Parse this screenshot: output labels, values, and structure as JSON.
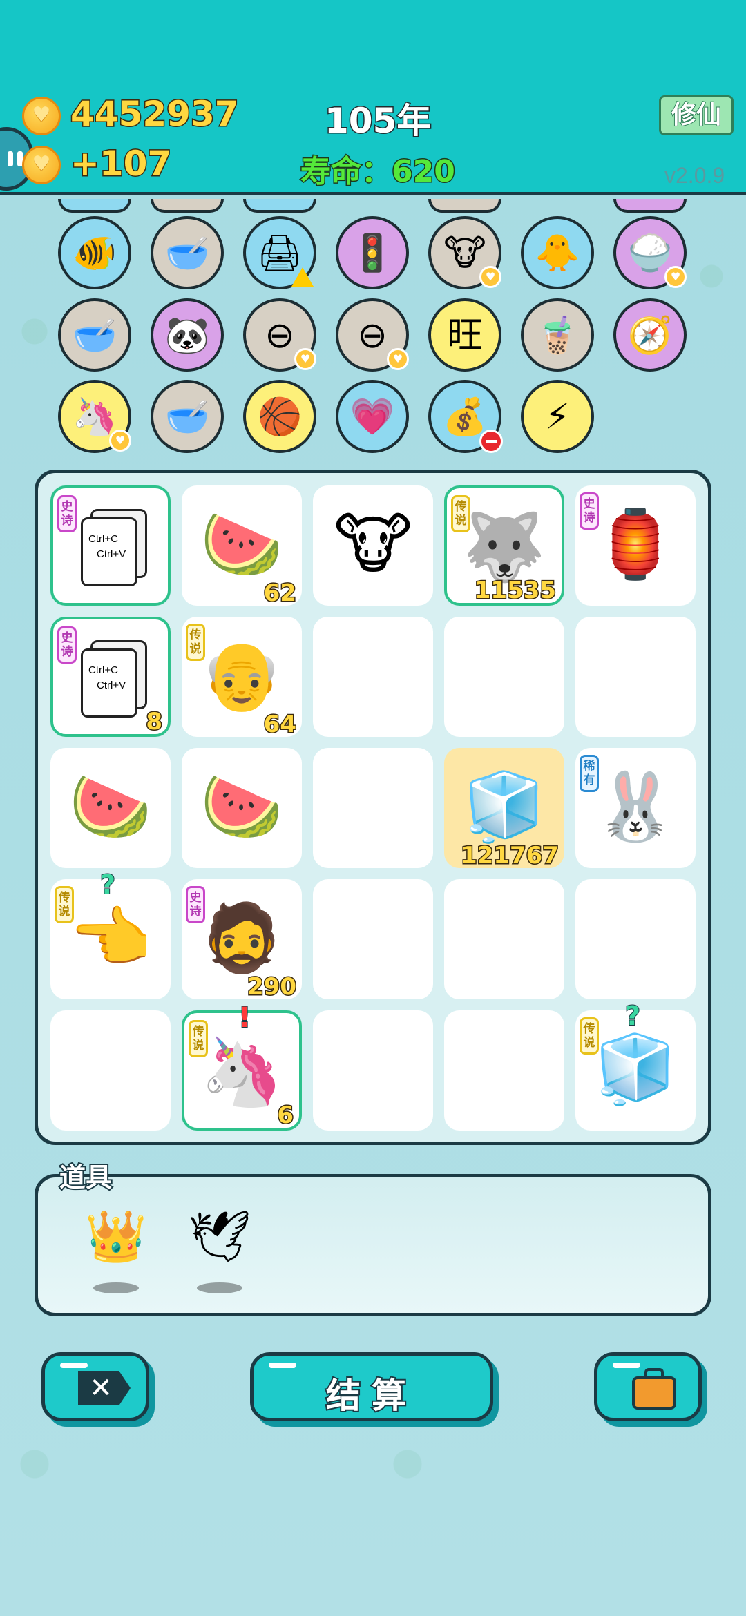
{
  "header": {
    "coins": "4452937",
    "income": "+107",
    "year": "105年",
    "lifespan_label": "寿命：",
    "lifespan_value": "620",
    "xiuxian_button": "修仙",
    "version": "v2.0.9"
  },
  "icons": {
    "row1": [
      {
        "name": "fish-bowl",
        "glyph": "🐠",
        "bg": "#8fd9f0",
        "badge": "none"
      },
      {
        "name": "pet-bowl",
        "glyph": "🥣",
        "bg": "#d7d0c4",
        "badge": "none"
      },
      {
        "name": "printer",
        "glyph": "🖨",
        "bg": "#8fd9f0",
        "badge": "warn"
      },
      {
        "name": "traffic-light",
        "glyph": "🚦",
        "bg": "#d9a2e8",
        "badge": "none"
      },
      {
        "name": "twin-cows",
        "glyph": "🐮",
        "bg": "#d7d0c4",
        "badge": "heart"
      },
      {
        "name": "chick-egg",
        "glyph": "🐥",
        "bg": "#8fd9f0",
        "badge": "none"
      },
      {
        "name": "rice-bowl",
        "glyph": "🍚",
        "bg": "#d9a2e8",
        "badge": "heart"
      }
    ],
    "row2": [
      {
        "name": "pet-bowl",
        "glyph": "🥣",
        "bg": "#d7d0c4",
        "badge": "none"
      },
      {
        "name": "panda",
        "glyph": "🐼",
        "bg": "#d9a2e8",
        "badge": "none"
      },
      {
        "name": "minus-sign",
        "glyph": "⊖",
        "bg": "#d7d0c4",
        "badge": "heart"
      },
      {
        "name": "minus-sign",
        "glyph": "⊖",
        "bg": "#d7d0c4",
        "badge": "heart"
      },
      {
        "name": "wang-chars",
        "glyph": "旺",
        "bg": "#fdf07a",
        "badge": "none"
      },
      {
        "name": "bubble-tea",
        "glyph": "🧋",
        "bg": "#d7d0c4",
        "badge": "none"
      },
      {
        "name": "compass",
        "glyph": "🧭",
        "bg": "#d9a2e8",
        "badge": "none"
      }
    ],
    "row3": [
      {
        "name": "unicorn",
        "glyph": "🦄",
        "bg": "#fdf07a",
        "badge": "heart"
      },
      {
        "name": "pet-bowl",
        "glyph": "🥣",
        "bg": "#d7d0c4",
        "badge": "none"
      },
      {
        "name": "basketballs",
        "glyph": "🏀",
        "bg": "#fdf07a",
        "badge": "none"
      },
      {
        "name": "heart-lollipop",
        "glyph": "💗",
        "bg": "#8fd9f0",
        "badge": "none"
      },
      {
        "name": "money-bag",
        "glyph": "💰",
        "bg": "#8fd9f0",
        "badge": "minus"
      },
      {
        "name": "lightning",
        "glyph": "⚡",
        "bg": "#fdf07a",
        "badge": "none"
      }
    ]
  },
  "board": {
    "rows": [
      [
        {
          "item": "copy-paste-card",
          "tag": "史诗",
          "tag_type": "epic",
          "count": "",
          "highlight": true,
          "card": {
            "line1": "Ctrl+C",
            "line2": "Ctrl+V"
          }
        },
        {
          "item": "watermelon",
          "art": "🍉",
          "count": "62"
        },
        {
          "item": "cow",
          "art": "🐮",
          "count": ""
        },
        {
          "item": "husky-king",
          "art": "🐺",
          "tag": "传说",
          "tag_type": "legend",
          "count": "11535",
          "highlight": true
        },
        {
          "item": "rabbit-house",
          "art": "🏮",
          "tag": "史诗",
          "tag_type": "epic",
          "count": ""
        }
      ],
      [
        {
          "item": "copy-paste-card",
          "tag": "史诗",
          "tag_type": "epic",
          "count": "8",
          "highlight": true,
          "card": {
            "line1": "Ctrl+C",
            "line2": "Ctrl+V"
          }
        },
        {
          "item": "bald-man",
          "art": "👴",
          "tag": "传说",
          "tag_type": "legend",
          "count": "64"
        },
        {
          "item": "empty"
        },
        {
          "item": "empty"
        },
        {
          "item": "empty"
        }
      ],
      [
        {
          "item": "watermelon",
          "art": "🍉",
          "count": ""
        },
        {
          "item": "watermelon",
          "art": "🍉",
          "count": ""
        },
        {
          "item": "empty"
        },
        {
          "item": "fridge",
          "art": "🧊",
          "count": "121767",
          "gold": true
        },
        {
          "item": "rabbit",
          "art": "🐰",
          "tag": "稀有",
          "tag_type": "rare",
          "count": ""
        }
      ],
      [
        {
          "item": "pointing-hand",
          "art": "👈",
          "tag": "传说",
          "tag_type": "legend",
          "count": "",
          "mark": "?"
        },
        {
          "item": "bearded-man",
          "art": "🧔",
          "tag": "史诗",
          "tag_type": "epic",
          "count": "290"
        },
        {
          "item": "empty"
        },
        {
          "item": "empty"
        },
        {
          "item": "empty"
        }
      ],
      [
        {
          "item": "empty"
        },
        {
          "item": "unicorn",
          "art": "🦄",
          "tag": "传说",
          "tag_type": "legend",
          "count": "6",
          "highlight": true,
          "mark": "!"
        },
        {
          "item": "empty"
        },
        {
          "item": "empty"
        },
        {
          "item": "fridge",
          "art": "🧊",
          "tag": "传说",
          "tag_type": "legend",
          "count": "",
          "mark": "?"
        }
      ]
    ]
  },
  "items_panel": {
    "title": "道具",
    "items": [
      {
        "name": "crown",
        "art": "👑"
      },
      {
        "name": "white-bird",
        "art": "🕊"
      }
    ]
  },
  "buttons": {
    "close_glyph": "✕",
    "settle": "结算"
  }
}
